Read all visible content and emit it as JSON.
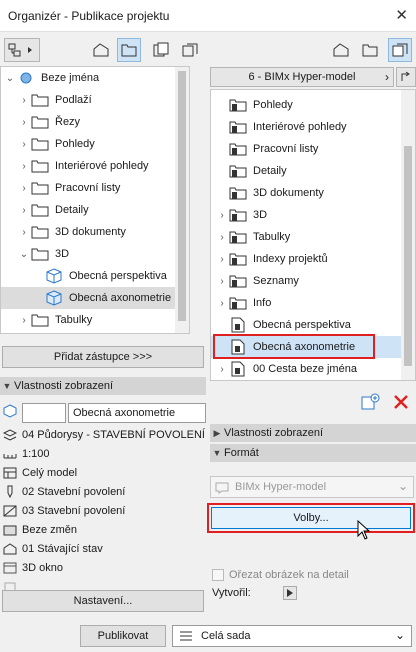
{
  "window": {
    "title": "Organizér - Publikace projektu",
    "close_glyph": "✕"
  },
  "left_tree": {
    "items": [
      {
        "label": "Beze jména",
        "level": 0,
        "expanded": true,
        "icon": "project-icon"
      },
      {
        "label": "Podlaží",
        "level": 1,
        "icon": "folder-icon"
      },
      {
        "label": "Řezy",
        "level": 1,
        "icon": "folder-icon"
      },
      {
        "label": "Pohledy",
        "level": 1,
        "icon": "folder-icon"
      },
      {
        "label": "Interiérové pohledy",
        "level": 1,
        "icon": "folder-icon"
      },
      {
        "label": "Pracovní listy",
        "level": 1,
        "icon": "folder-icon"
      },
      {
        "label": "Detaily",
        "level": 1,
        "icon": "folder-icon"
      },
      {
        "label": "3D dokumenty",
        "level": 1,
        "icon": "folder-icon"
      },
      {
        "label": "3D",
        "level": 1,
        "expanded": true,
        "icon": "folder-icon"
      },
      {
        "label": "Obecná perspektiva",
        "level": 2,
        "icon": "cube-icon"
      },
      {
        "label": "Obecná axonometrie",
        "level": 2,
        "icon": "cube-icon",
        "selected": true
      },
      {
        "label": "Tabulky",
        "level": 1,
        "icon": "folder-icon"
      }
    ]
  },
  "left_buttons": {
    "add_placeholder": "Přidat zástupce >>>",
    "settings": "Nastavení..."
  },
  "view_props": {
    "header": "Vlastnosti zobrazení",
    "id_value": "",
    "name_value": "Obecná axonometrie",
    "rows": [
      {
        "icon": "layers-icon",
        "label": "04 Půdorysy - STAVEBNÍ POVOLENÍ"
      },
      {
        "icon": "scale-icon",
        "label": "1:100"
      },
      {
        "icon": "model-icon",
        "label": "Celý model"
      },
      {
        "icon": "pen-icon",
        "label": "02 Stavební povolení"
      },
      {
        "icon": "override-icon",
        "label": "03 Stavební povolení"
      },
      {
        "icon": "renovation-icon",
        "label": "Beze změn"
      },
      {
        "icon": "house-icon",
        "label": "01 Stávající stav"
      },
      {
        "icon": "window-icon",
        "label": "3D okno"
      },
      {
        "icon": "image-icon",
        "label": ""
      }
    ]
  },
  "right_header": {
    "set_name": "6 - BIMx Hyper-model"
  },
  "right_tree": {
    "items": [
      {
        "label": "Pohledy",
        "icon": "folder-doc-icon"
      },
      {
        "label": "Interiérové pohledy",
        "icon": "folder-doc-icon"
      },
      {
        "label": "Pracovní listy",
        "icon": "folder-doc-icon"
      },
      {
        "label": "Detaily",
        "icon": "folder-doc-icon"
      },
      {
        "label": "3D dokumenty",
        "icon": "folder-doc-icon"
      },
      {
        "label": "3D",
        "icon": "folder-doc-icon",
        "has_chevron": true
      },
      {
        "label": "Tabulky",
        "icon": "folder-doc-icon",
        "has_chevron": true
      },
      {
        "label": "Indexy projektů",
        "icon": "folder-doc-icon",
        "has_chevron": true
      },
      {
        "label": "Seznamy",
        "icon": "folder-doc-icon",
        "has_chevron": true
      },
      {
        "label": "Info",
        "icon": "folder-doc-icon",
        "has_chevron": true
      },
      {
        "label": "Obecná perspektiva",
        "icon": "doc-icon"
      },
      {
        "label": "Obecná axonometrie",
        "icon": "doc-icon",
        "selected": true,
        "highlighted": true
      },
      {
        "label": "00 Cesta beze jména",
        "icon": "doc-icon",
        "has_chevron": true
      }
    ]
  },
  "right_sections": {
    "view_props": "Vlastnosti zobrazení",
    "format": "Formát",
    "format_value": "BIMx Hyper-model",
    "options_button": "Volby...",
    "crop_label": "Ořezat obrázek na detail",
    "created_label": "Vytvořil:"
  },
  "bottom": {
    "publish": "Publikovat",
    "set_value": "Celá sada"
  },
  "colors": {
    "selection": "#cfe3f7",
    "highlight_border": "#e02020",
    "delete_icon": "#e02020",
    "add_icon": "#2b79c9"
  }
}
